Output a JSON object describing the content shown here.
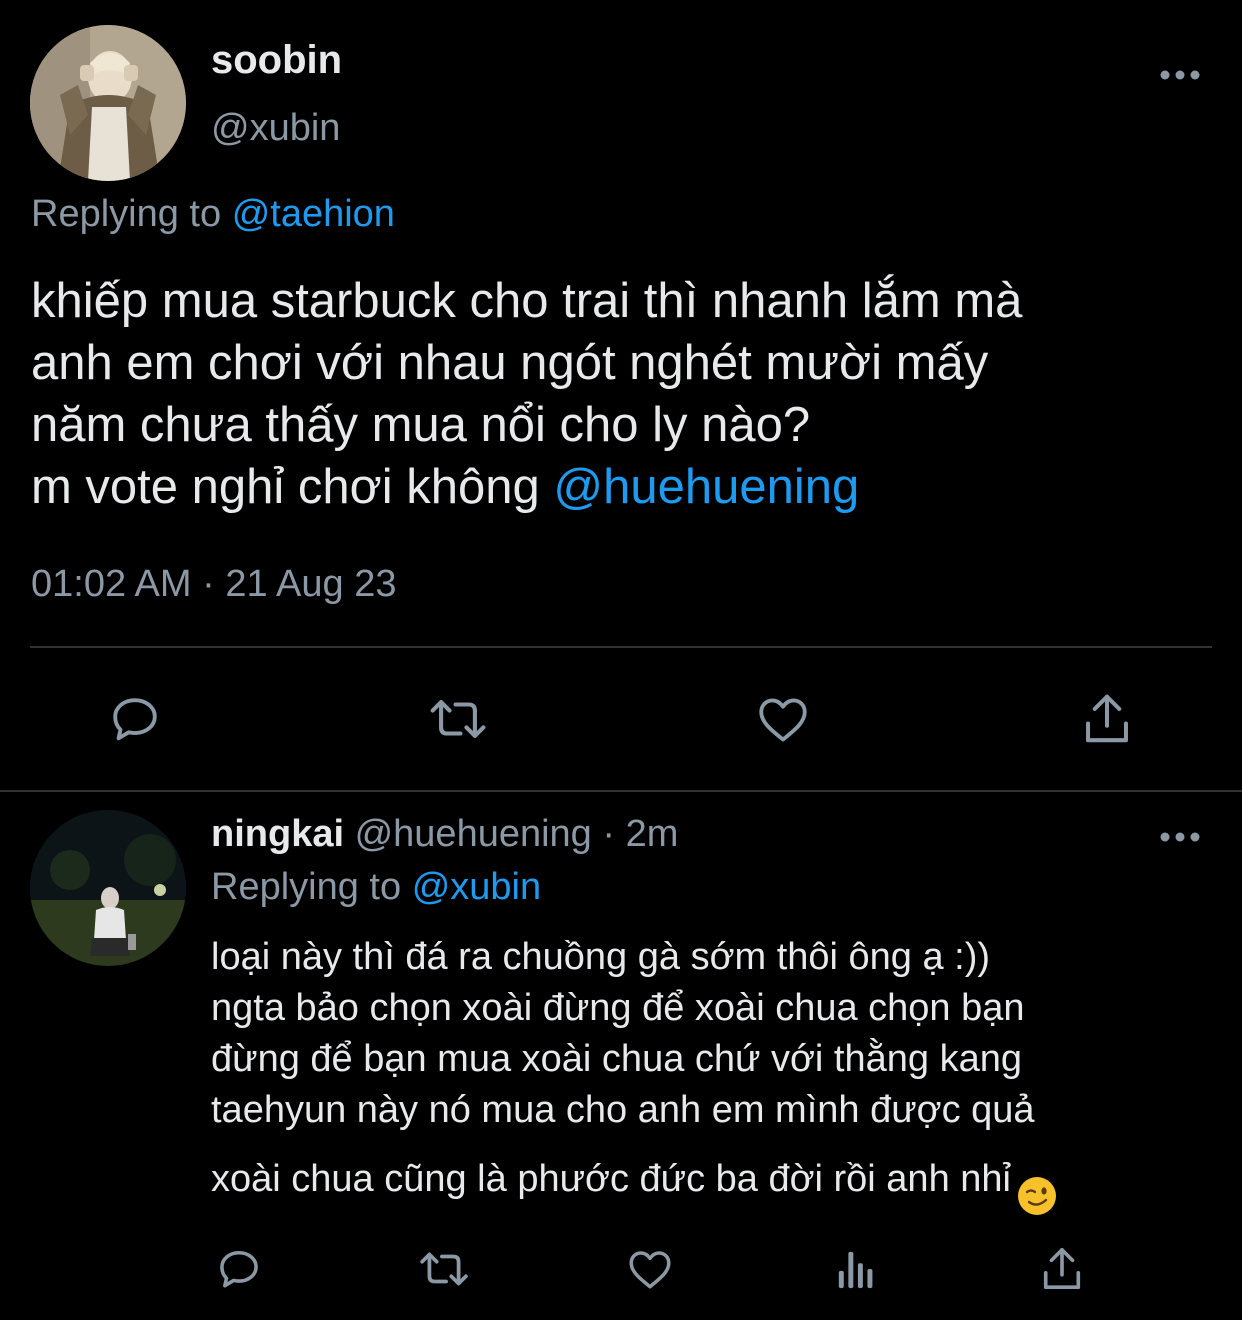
{
  "main_tweet": {
    "display_name": "soobin",
    "handle": "@xubin",
    "replying_prefix": "Replying to",
    "replying_to": "@taehion",
    "text_lines": [
      "khiếp mua starbuck cho trai thì nhanh lắm mà",
      "anh em chơi với nhau ngót nghét mười mấy",
      "năm chưa thấy mua nổi cho ly nào?"
    ],
    "last_line_text": "m vote nghỉ chơi không ",
    "last_line_mention": "@huehuening",
    "timestamp": "01:02 AM · 21 Aug 23",
    "actions": [
      "reply-icon",
      "retweet-icon",
      "like-icon",
      "share-icon"
    ]
  },
  "reply_tweet": {
    "display_name": "ningkai",
    "handle_and_time": " @huehuening · 2m",
    "replying_prefix": "Replying to",
    "replying_to": "@xubin",
    "text_lines": [
      "loại này thì đá ra chuồng gà sớm thôi ông ạ :))",
      "ngta bảo chọn xoài đừng để xoài chua chọn bạn",
      "đừng để bạn mua xoài chua chứ với thằng kang",
      "taehyun này nó mua cho anh em mình được quả",
      "xoài chua cũng là phước đức ba đời rồi anh nhỉ"
    ],
    "emoji": "winking-face",
    "actions": [
      "reply-icon",
      "retweet-icon",
      "like-icon",
      "analytics-icon",
      "share-icon"
    ]
  },
  "colors": {
    "background": "#000000",
    "text_primary": "#e7e9ea",
    "text_secondary": "#8b98a5",
    "link": "#1d9bf0",
    "divider": "#2f3336"
  }
}
